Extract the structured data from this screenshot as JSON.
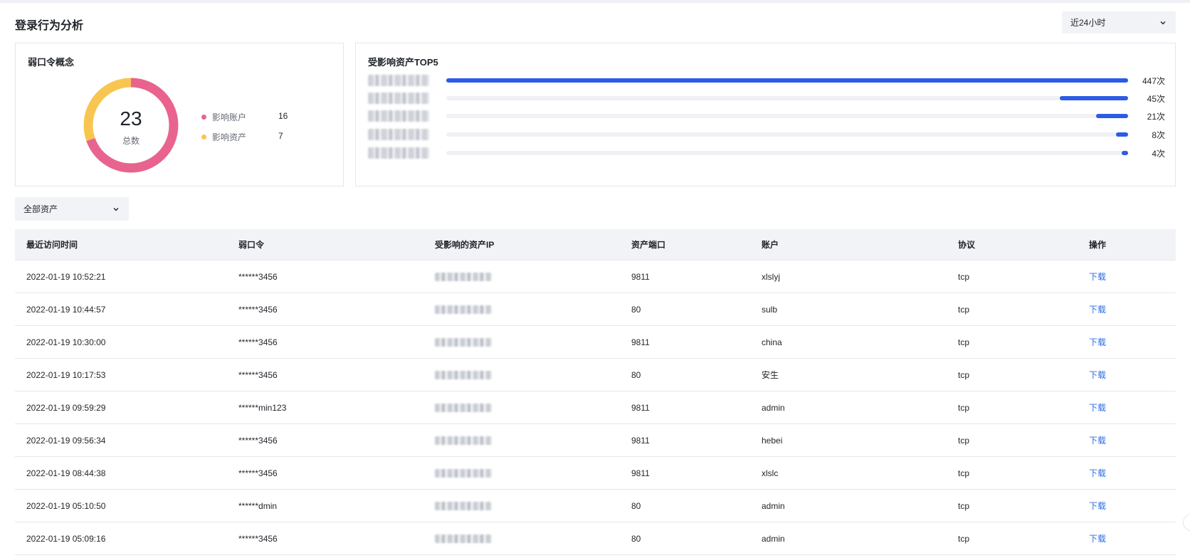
{
  "header": {
    "title": "登录行为分析",
    "time_range": "近24小时"
  },
  "weak_password": {
    "title": "弱口令概念",
    "total": "23",
    "total_label": "总数",
    "colors": {
      "accounts": "#e8648f",
      "assets": "#f8c650"
    },
    "legend": [
      {
        "name": "影响账户",
        "value": "16"
      },
      {
        "name": "影响资产",
        "value": "7"
      }
    ]
  },
  "top_assets": {
    "title": "受影响资产TOP5",
    "accent": "#2b5ce6",
    "items": [
      {
        "value": 447,
        "label": "447次"
      },
      {
        "value": 45,
        "label": "45次"
      },
      {
        "value": 21,
        "label": "21次"
      },
      {
        "value": 8,
        "label": "8次"
      },
      {
        "value": 4,
        "label": "4次"
      }
    ]
  },
  "filter": {
    "asset_select": "全部资产"
  },
  "table": {
    "columns": [
      "最近访问时间",
      "弱口令",
      "受影响的资产IP",
      "资产端口",
      "账户",
      "协议",
      "操作"
    ],
    "rows": [
      {
        "time": "2022-01-19 10:52:21",
        "password": "******3456",
        "port": "9811",
        "account": "xlslyj",
        "protocol": "tcp",
        "action": "下载"
      },
      {
        "time": "2022-01-19 10:44:57",
        "password": "******3456",
        "port": "80",
        "account": "sulb",
        "protocol": "tcp",
        "action": "下载"
      },
      {
        "time": "2022-01-19 10:30:00",
        "password": "******3456",
        "port": "9811",
        "account": "china",
        "protocol": "tcp",
        "action": "下载"
      },
      {
        "time": "2022-01-19 10:17:53",
        "password": "******3456",
        "port": "80",
        "account": "安生",
        "protocol": "tcp",
        "action": "下载"
      },
      {
        "time": "2022-01-19 09:59:29",
        "password": "******min123",
        "port": "9811",
        "account": "admin",
        "protocol": "tcp",
        "action": "下载"
      },
      {
        "time": "2022-01-19 09:56:34",
        "password": "******3456",
        "port": "9811",
        "account": "hebei",
        "protocol": "tcp",
        "action": "下载"
      },
      {
        "time": "2022-01-19 08:44:38",
        "password": "******3456",
        "port": "9811",
        "account": "xlslc",
        "protocol": "tcp",
        "action": "下载"
      },
      {
        "time": "2022-01-19 05:10:50",
        "password": "******dmin",
        "port": "80",
        "account": "admin",
        "protocol": "tcp",
        "action": "下载"
      },
      {
        "time": "2022-01-19 05:09:16",
        "password": "******3456",
        "port": "80",
        "account": "admin",
        "protocol": "tcp",
        "action": "下载"
      }
    ]
  }
}
